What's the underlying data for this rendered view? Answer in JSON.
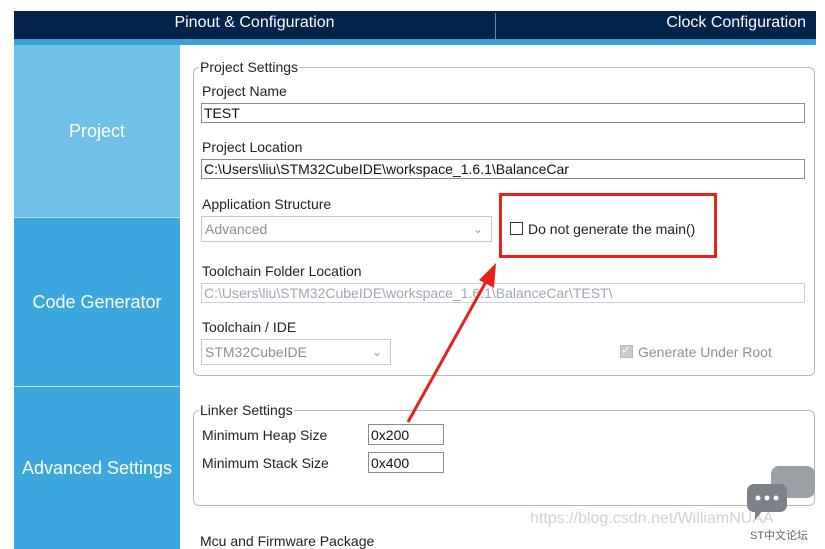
{
  "tabs": {
    "pinout": "Pinout & Configuration",
    "clock": "Clock Configuration"
  },
  "sidebar": {
    "items": [
      {
        "label": "Project"
      },
      {
        "label": "Code Generator"
      },
      {
        "label": "Advanced Settings"
      }
    ]
  },
  "project_settings": {
    "legend": "Project Settings",
    "project_name_label": "Project Name",
    "project_name_value": "TEST",
    "project_location_label": "Project Location",
    "project_location_value": "C:\\Users\\liu\\STM32CubeIDE\\workspace_1.6.1\\BalanceCar",
    "app_structure_label": "Application Structure",
    "app_structure_value": "Advanced",
    "do_not_generate_main_label": "Do not generate the main()",
    "do_not_generate_main_checked": false,
    "toolchain_folder_label": "Toolchain Folder Location",
    "toolchain_folder_value": "C:\\Users\\liu\\STM32CubeIDE\\workspace_1.6.1\\BalanceCar\\TEST\\",
    "toolchain_ide_label": "Toolchain / IDE",
    "toolchain_ide_value": "STM32CubeIDE",
    "generate_under_root_label": "Generate Under Root",
    "generate_under_root_checked": true
  },
  "linker_settings": {
    "legend": "Linker Settings",
    "min_heap_label": "Minimum Heap Size",
    "min_heap_value": "0x200",
    "min_stack_label": "Minimum Stack Size",
    "min_stack_value": "0x400"
  },
  "next_section_label": "Mcu and Firmware Package",
  "watermark": "https://blog.csdn.net/WilliamNUAA",
  "brand": "ST中文论坛",
  "colors": {
    "topbar": "#03234b",
    "accent": "#3ca7df",
    "highlight": "#e8201a"
  }
}
